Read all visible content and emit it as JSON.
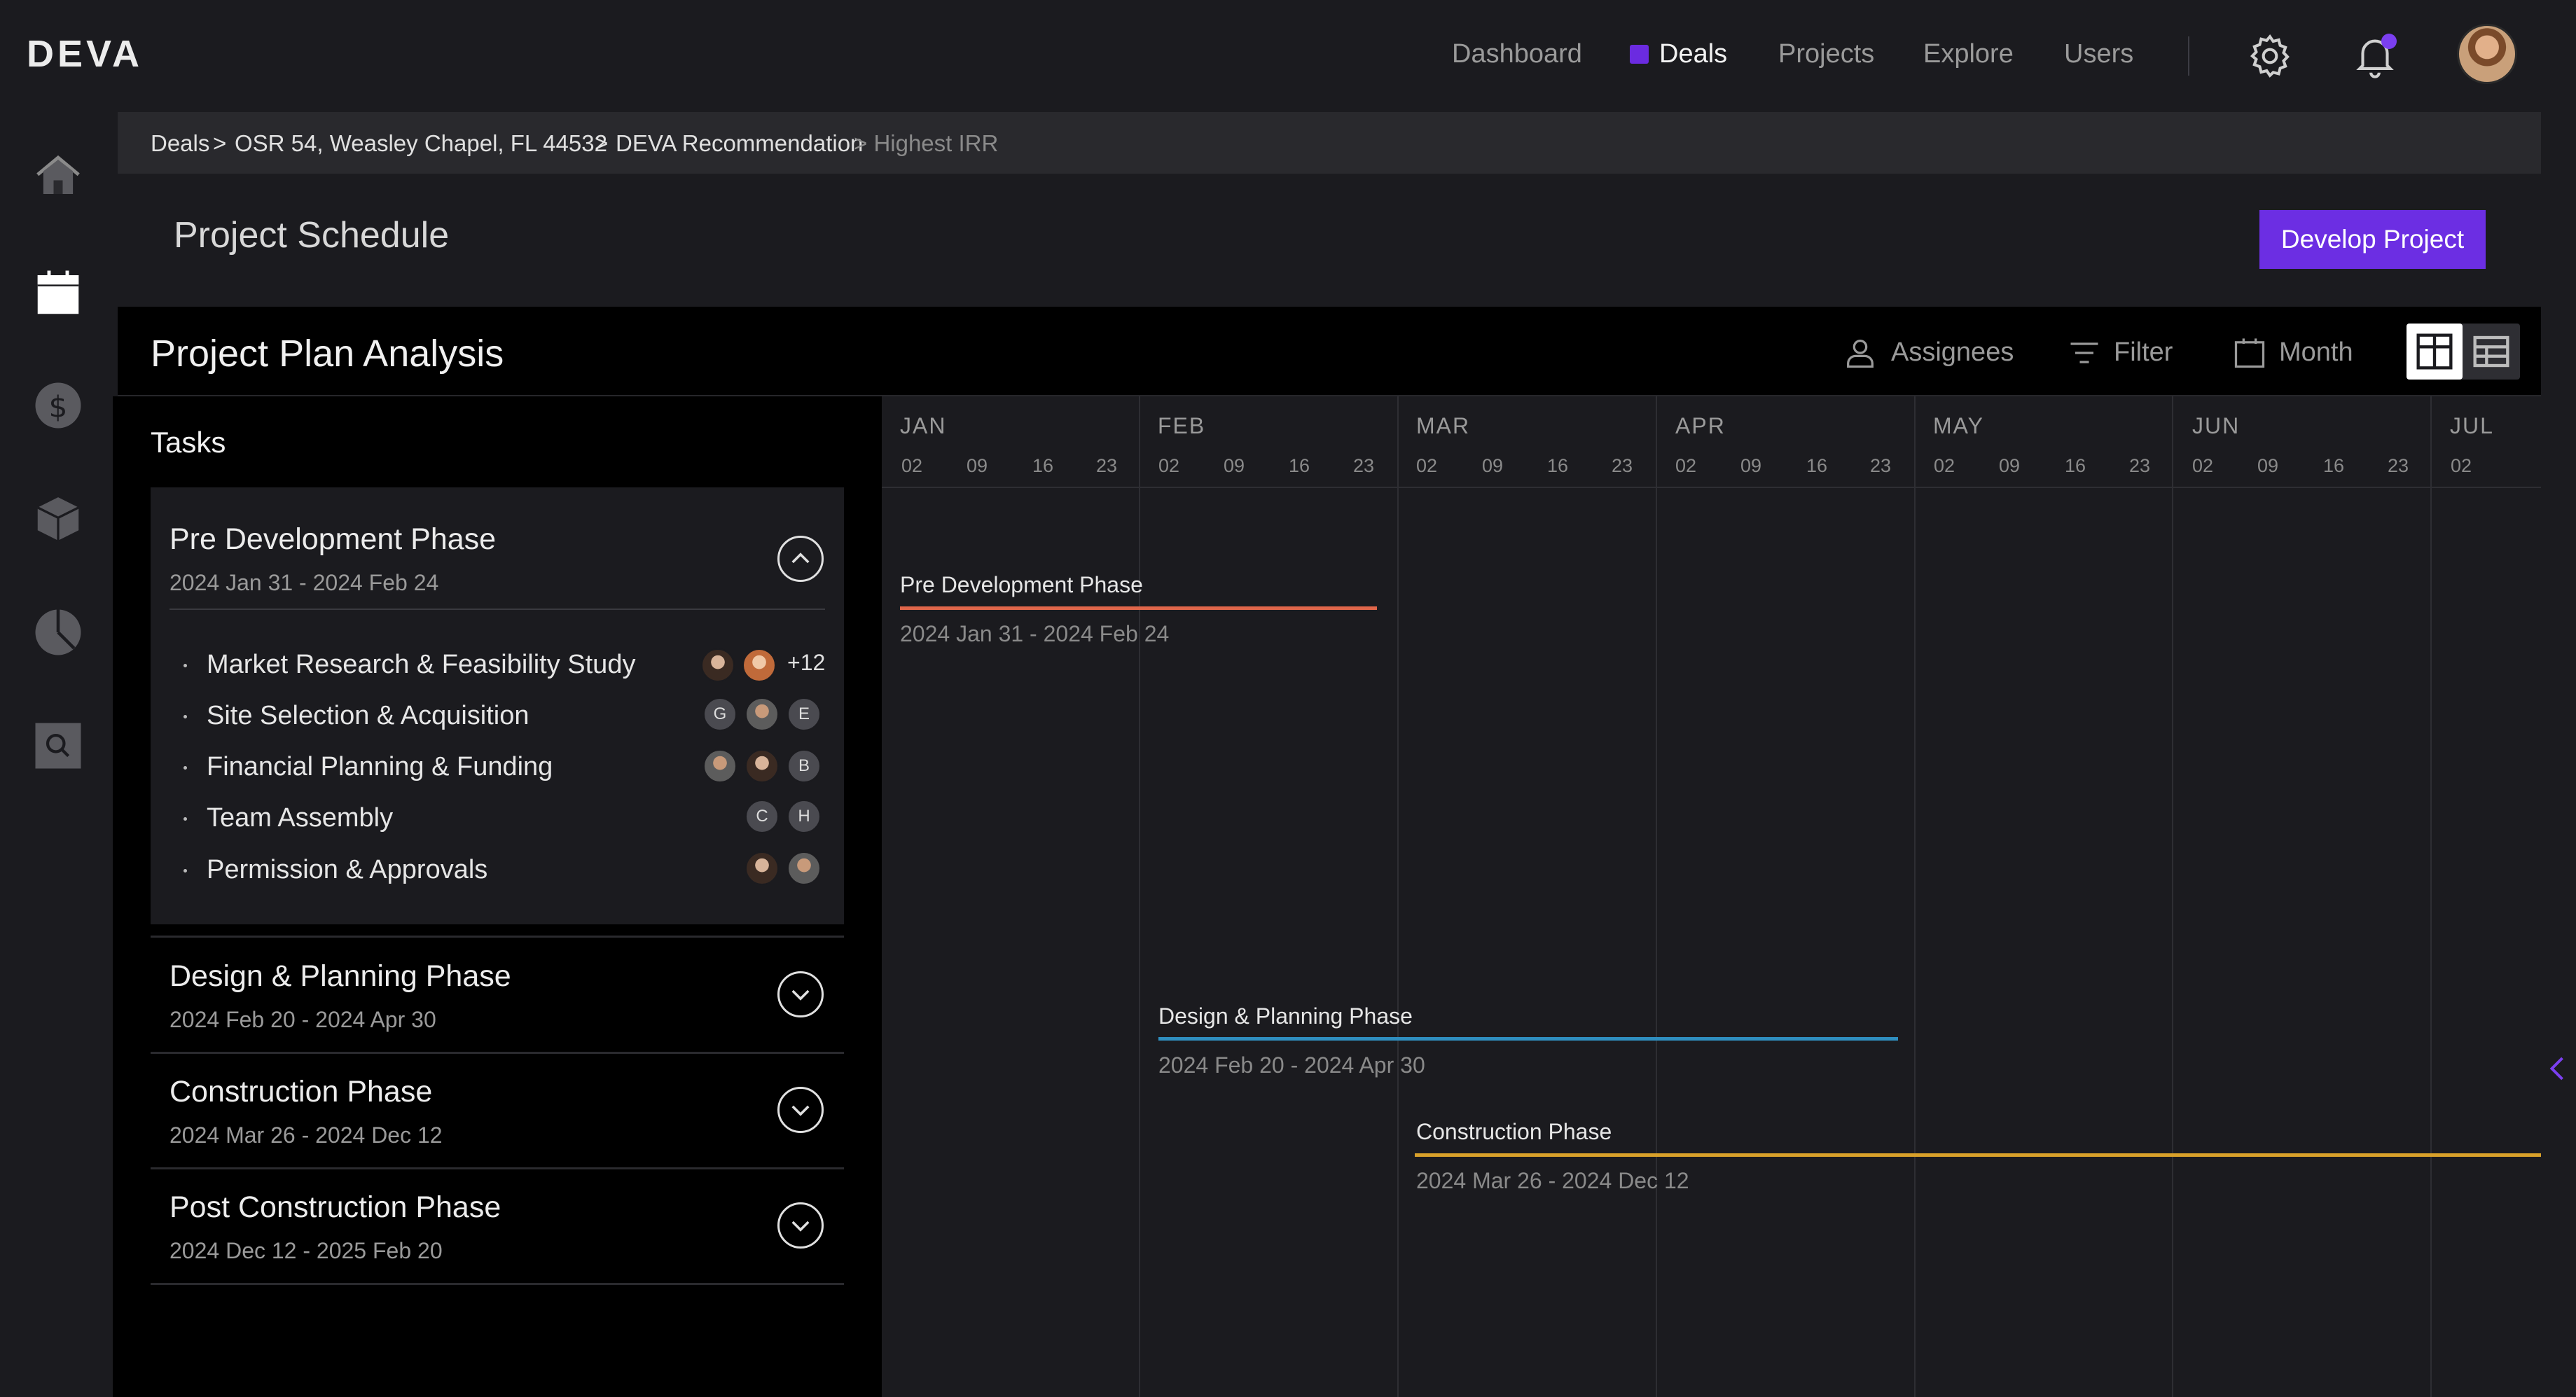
{
  "app": {
    "logo": "DEVA"
  },
  "topnav": {
    "items": [
      {
        "label": "Dashboard",
        "active": false
      },
      {
        "label": "Deals",
        "active": true
      },
      {
        "label": "Projects",
        "active": false
      },
      {
        "label": "Explore",
        "active": false
      },
      {
        "label": "Users",
        "active": false
      }
    ]
  },
  "sidebar": {
    "icons": [
      "home-icon",
      "calendar-icon",
      "dollar-icon",
      "box-icon",
      "pie-chart-icon",
      "search-icon"
    ]
  },
  "breadcrumb": {
    "items": [
      "Deals",
      ">",
      "OSR 54, Weasley Chapel, FL 44532",
      ">",
      "DEVA Recommendation",
      "> Highest IRR"
    ]
  },
  "header": {
    "title": "Project Schedule",
    "primary_button": "Develop Project"
  },
  "panel": {
    "title": "Project Plan Analysis",
    "tools": {
      "assignees": "Assignees",
      "filter": "Filter",
      "month": "Month"
    }
  },
  "tasks": {
    "label": "Tasks",
    "phases": [
      {
        "name": "Pre Development Phase",
        "dates": "2024 Jan 31 - 2024 Feb 24",
        "expanded": true,
        "tasks": [
          {
            "name": "Market Research & Feasibility Study",
            "assignees": [
              "photo",
              "photo"
            ],
            "more": "+12"
          },
          {
            "name": "Site Selection & Acquisition",
            "assignees": [
              "G",
              "photo",
              "E"
            ]
          },
          {
            "name": "Financial Planning & Funding",
            "assignees": [
              "photo",
              "photo",
              "B"
            ]
          },
          {
            "name": "Team Assembly",
            "assignees": [
              "C",
              "H"
            ]
          },
          {
            "name": "Permission & Approvals",
            "assignees": [
              "photo",
              "photo"
            ]
          }
        ]
      },
      {
        "name": "Design & Planning Phase",
        "dates": "2024 Feb 20 - 2024 Apr 30",
        "expanded": false
      },
      {
        "name": "Construction Phase",
        "dates": "2024 Mar 26 - 2024 Dec 12",
        "expanded": false
      },
      {
        "name": "Post Construction Phase",
        "dates": "2024 Dec 12 - 2025 Feb 20",
        "expanded": false
      }
    ]
  },
  "gantt": {
    "months": [
      "JAN",
      "FEB",
      "MAR",
      "APR",
      "MAY",
      "JUN",
      "JUL"
    ],
    "days": [
      "02",
      "09",
      "16",
      "23"
    ],
    "last_day": "02",
    "bars": [
      {
        "name": "Pre Development Phase",
        "dates": "2024 Jan 31 - 2024 Feb 24",
        "color": "#e0664a"
      },
      {
        "name": "Design & Planning Phase",
        "dates": "2024 Feb 20 - 2024 Apr 30",
        "color": "#2f8fc0"
      },
      {
        "name": "Construction Phase",
        "dates": "2024 Mar 26 - 2024 Dec 12",
        "color": "#d9a12a"
      }
    ]
  },
  "colors": {
    "accent": "#6c2ee3",
    "background": "#1b1b1f",
    "panel": "#000000"
  }
}
